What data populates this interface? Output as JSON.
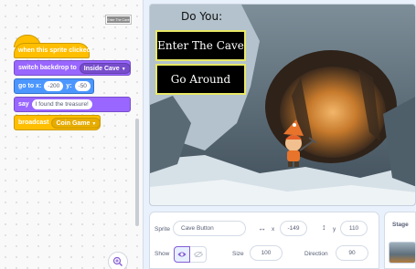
{
  "code_area": {
    "sprite_thumbnail_label": "Enter The Cave",
    "blocks": {
      "hat_label": "when this sprite clicked",
      "backdrop_label": "switch backdrop to",
      "backdrop_value": "Inside Cave",
      "goto_label": "go to x:",
      "goto_x": "-200",
      "goto_y_label": "y:",
      "goto_y": "-50",
      "say_label": "say",
      "say_value": "I found the treasure!",
      "broadcast_label": "broadcast",
      "broadcast_value": "Coin Game"
    }
  },
  "stage": {
    "title": "Do You:",
    "button_enter": "Enter The Cave",
    "button_around": "Go Around"
  },
  "sprite_info": {
    "sprite_label": "Sprite",
    "sprite_name": "Cave Button",
    "x_label": "x",
    "x_value": "-149",
    "y_label": "y",
    "y_value": "110",
    "show_label": "Show",
    "size_label": "Size",
    "size_value": "100",
    "direction_label": "Direction",
    "direction_value": "90"
  },
  "stage_panel": {
    "title": "Stage"
  },
  "colors": {
    "events": "#ffbf00",
    "looks": "#9966ff",
    "motion": "#4c97ff",
    "button_border": "#e8e866"
  }
}
